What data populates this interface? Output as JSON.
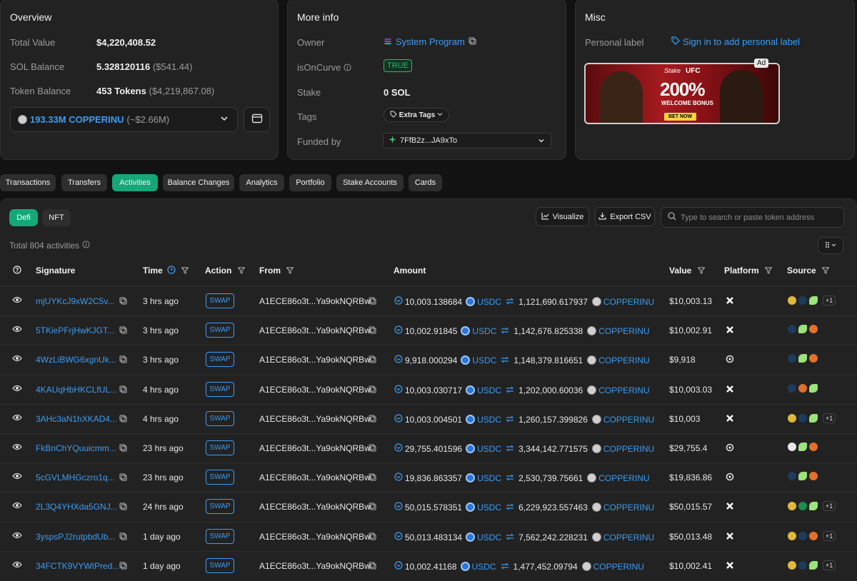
{
  "overview": {
    "title": "Overview",
    "total_value_label": "Total Value",
    "total_value": "$4,220,408.52",
    "sol_balance_label": "SOL Balance",
    "sol_balance": "5.328120116",
    "sol_balance_usd": "($541.44)",
    "token_balance_label": "Token Balance",
    "token_balance": "453 Tokens",
    "token_balance_usd": "($4,219,867.08)",
    "token_select_name": "193.33M COPPERINU",
    "token_select_usd": "(~$2.66M)"
  },
  "more_info": {
    "title": "More info",
    "owner_label": "Owner",
    "owner_value": "System Program",
    "oncurve_label": "isOnCurve",
    "oncurve_value": "TRUE",
    "stake_label": "Stake",
    "stake_value": "0 SOL",
    "tags_label": "Tags",
    "tags_value": "Extra Tags",
    "funded_label": "Funded by",
    "funded_value": "7FfB2z...JA9xTo"
  },
  "misc": {
    "title": "Misc",
    "personal_label": "Personal label",
    "signin_link": "Sign in to add personal label",
    "ad_tag": "Ad",
    "ad_brand": "Stake",
    "ad_partner": "UFC",
    "ad_headline": "200%",
    "ad_sub": "WELCOME BONUS",
    "ad_cta": "BET NOW"
  },
  "tabs": [
    "Transactions",
    "Transfers",
    "Activities",
    "Balance Changes",
    "Analytics",
    "Portfolio",
    "Stake Accounts",
    "Cards"
  ],
  "active_tab": "Activities",
  "toolbar": {
    "defi": "Defi",
    "nft": "NFT",
    "visualize": "Visualize",
    "export": "Export CSV",
    "search_placeholder": "Type to search or paste token address",
    "total": "Total 804 activities"
  },
  "columns": {
    "signature": "Signature",
    "time": "Time",
    "action": "Action",
    "from": "From",
    "amount": "Amount",
    "value": "Value",
    "platform": "Platform",
    "source": "Source"
  },
  "rows": [
    {
      "sig": "mjUYKcJ9xW2C5v...",
      "time": "3 hrs ago",
      "action": "SWAP",
      "from": "A1ECE86o3t...Ya9okNQRBw",
      "amt_in": "10,003.138684",
      "tok_in": "USDC",
      "amt_out": "1,121,690.617937",
      "tok_out": "COPPERINU",
      "value": "$10,003.13",
      "more": "+1"
    },
    {
      "sig": "5TKiePFrjHwKJGT...",
      "time": "3 hrs ago",
      "action": "SWAP",
      "from": "A1ECE86o3t...Ya9okNQRBw",
      "amt_in": "10,002.91845",
      "tok_in": "USDC",
      "amt_out": "1,142,676.825338",
      "tok_out": "COPPERINU",
      "value": "$10,002.91",
      "more": ""
    },
    {
      "sig": "4WzLiBWG6xgnUk...",
      "time": "3 hrs ago",
      "action": "SWAP",
      "from": "A1ECE86o3t...Ya9okNQRBw",
      "amt_in": "9,918.000294",
      "tok_in": "USDC",
      "amt_out": "1,148,379.816651",
      "tok_out": "COPPERINU",
      "value": "$9,918",
      "more": ""
    },
    {
      "sig": "4KAUqHbHKCLfUL...",
      "time": "4 hrs ago",
      "action": "SWAP",
      "from": "A1ECE86o3t...Ya9okNQRBw",
      "amt_in": "10,003.030717",
      "tok_in": "USDC",
      "amt_out": "1,202,000.60036",
      "tok_out": "COPPERINU",
      "value": "$10,003.03",
      "more": ""
    },
    {
      "sig": "3AHc3aN1hXKAD4...",
      "time": "4 hrs ago",
      "action": "SWAP",
      "from": "A1ECE86o3t...Ya9okNQRBw",
      "amt_in": "10,003.004501",
      "tok_in": "USDC",
      "amt_out": "1,260,157.399826",
      "tok_out": "COPPERINU",
      "value": "$10,003",
      "more": "+1"
    },
    {
      "sig": "FkBnChYQuuicmm...",
      "time": "23 hrs ago",
      "action": "SWAP",
      "from": "A1ECE86o3t...Ya9okNQRBw",
      "amt_in": "29,755.401596",
      "tok_in": "USDC",
      "amt_out": "3,344,142.771575",
      "tok_out": "COPPERINU",
      "value": "$29,755.4",
      "more": ""
    },
    {
      "sig": "5cGVLMHGczro1q...",
      "time": "23 hrs ago",
      "action": "SWAP",
      "from": "A1ECE86o3t...Ya9okNQRBw",
      "amt_in": "19,836.863357",
      "tok_in": "USDC",
      "amt_out": "2,530,739.75661",
      "tok_out": "COPPERINU",
      "value": "$19,836.86",
      "more": ""
    },
    {
      "sig": "2L3Q4YHXda5GNJ...",
      "time": "24 hrs ago",
      "action": "SWAP",
      "from": "A1ECE86o3t...Ya9okNQRBw",
      "amt_in": "50,015.578351",
      "tok_in": "USDC",
      "amt_out": "6,229,923.557463",
      "tok_out": "COPPERINU",
      "value": "$50,015.57",
      "more": "+1"
    },
    {
      "sig": "3yspsPJ2rutpbdUb...",
      "time": "1 day ago",
      "action": "SWAP",
      "from": "A1ECE86o3t...Ya9okNQRBw",
      "amt_in": "50,013.483134",
      "tok_in": "USDC",
      "amt_out": "7,562,242.228231",
      "tok_out": "COPPERINU",
      "value": "$50,013.48",
      "more": "+1"
    },
    {
      "sig": "34FCTK9VYWtPred...",
      "time": "1 day ago",
      "action": "SWAP",
      "from": "A1ECE86o3t...Ya9okNQRBw",
      "amt_in": "10,002.41168",
      "tok_in": "USDC",
      "amt_out": "1,477,452.09794",
      "tok_out": "COPPERINU",
      "value": "$10,002.41",
      "more": "+1"
    }
  ],
  "colors": {
    "accent": "#15a77a",
    "link": "#3b9cf3",
    "bg": "#121212",
    "card": "#222222"
  }
}
